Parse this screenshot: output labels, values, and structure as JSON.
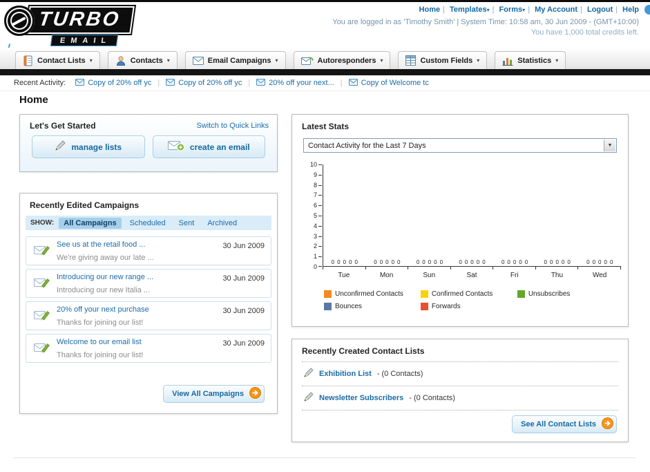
{
  "colors": {
    "link_blue": "#1b6ca8",
    "accent_orange": "#f7941d",
    "nav_black": "#141414"
  },
  "header": {
    "logo_title": "TURBO",
    "logo_subtitle": "EMAIL",
    "links": [
      {
        "label": "Home"
      },
      {
        "label": "Templates"
      },
      {
        "label": "Forms"
      },
      {
        "label": "My Account"
      },
      {
        "label": "Logout"
      },
      {
        "label": "Help"
      }
    ],
    "session_line": "You are logged in as 'Timothy Smith' | System Time: 10:58 am, 30 Jun 2009 - (GMT+10:00)",
    "credits_line": "You have 1,000 total credits left."
  },
  "nav_tabs": [
    {
      "label": "Contact Lists"
    },
    {
      "label": "Contacts"
    },
    {
      "label": "Email Campaigns"
    },
    {
      "label": "Autoresponders"
    },
    {
      "label": "Custom Fields"
    },
    {
      "label": "Statistics"
    }
  ],
  "recent_activity": {
    "label": "Recent Activity:",
    "items": [
      {
        "title": "Copy of 20% off yc"
      },
      {
        "title": "Copy of 20% off yc"
      },
      {
        "title": "20% off your next..."
      },
      {
        "title": "Copy of Welcome tc"
      }
    ]
  },
  "page_title": "Home",
  "get_started": {
    "title": "Let's Get Started",
    "switch_link": "Switch to Quick Links",
    "manage_lists_label": "manage lists",
    "create_email_label": "create an email"
  },
  "campaigns": {
    "title": "Recently Edited Campaigns",
    "show_label": "SHOW:",
    "filters": [
      "All Campaigns",
      "Scheduled",
      "Sent",
      "Archived"
    ],
    "items": [
      {
        "title": "See us at the retail food ...",
        "subtitle": "We're giving away our late ...",
        "date": "30 Jun 2009"
      },
      {
        "title": "Introducing our new range ...",
        "subtitle": "Introducing our new Italia ...",
        "date": "30 Jun 2009"
      },
      {
        "title": "20% off your next purchase",
        "subtitle": "Thanks for joining our list!",
        "date": "30 Jun 2009"
      },
      {
        "title": "Welcome to our email list",
        "subtitle": "Thanks for joining our list!",
        "date": "30 Jun 2009"
      }
    ],
    "view_all_label": "View All Campaigns"
  },
  "stats": {
    "title": "Latest Stats",
    "dropdown_value": "Contact Activity for the Last 7 Days",
    "chart_data": {
      "type": "bar",
      "categories": [
        "Tue",
        "Mon",
        "Sun",
        "Sat",
        "Fri",
        "Thu",
        "Wed"
      ],
      "series": [
        {
          "name": "Unconfirmed Contacts",
          "color": "#f68a1e",
          "values": [
            0,
            0,
            0,
            0,
            0,
            0,
            0
          ]
        },
        {
          "name": "Confirmed Contacts",
          "color": "#fdd108",
          "values": [
            0,
            0,
            0,
            0,
            0,
            0,
            0
          ]
        },
        {
          "name": "Unsubscribes",
          "color": "#64a72a",
          "values": [
            0,
            0,
            0,
            0,
            0,
            0,
            0
          ]
        },
        {
          "name": "Bounces",
          "color": "#5b77a8",
          "values": [
            0,
            0,
            0,
            0,
            0,
            0,
            0
          ]
        },
        {
          "name": "Forwards",
          "color": "#e8512e",
          "values": [
            0,
            0,
            0,
            0,
            0,
            0,
            0
          ]
        }
      ],
      "ylim": [
        0,
        10
      ],
      "yticks": [
        0,
        1,
        2,
        3,
        4,
        5,
        6,
        7,
        8,
        9,
        10
      ],
      "grid": false,
      "legend_position": "bottom"
    }
  },
  "contact_lists": {
    "title": "Recently Created Contact Lists",
    "items": [
      {
        "name": "Exhibition List",
        "detail": "- (0 Contacts)"
      },
      {
        "name": "Newsletter Subscribers",
        "detail": "- (0 Contacts)"
      }
    ],
    "see_all_label": "See All Contact Lists"
  }
}
